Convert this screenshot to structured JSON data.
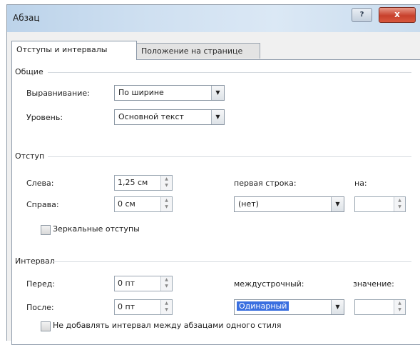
{
  "window": {
    "title": "Абзац",
    "help_label": "?",
    "close_label": "x"
  },
  "tabs": [
    {
      "label": "Отступы и интервалы"
    },
    {
      "label": "Положение на странице"
    }
  ],
  "general": {
    "heading": "Общие",
    "alignment_label": "Выравнивание:",
    "alignment_value": "По ширине",
    "level_label": "Уровень:",
    "level_value": "Основной текст"
  },
  "indent": {
    "heading": "Отступ",
    "left_label": "Слева:",
    "left_value": "1,25 см",
    "right_label": "Справа:",
    "right_value": "0 см",
    "first_line_label": "первая строка:",
    "first_line_value": "(нет)",
    "by_label": "на:",
    "by_value": "",
    "mirror_label": "Зеркальные отступы"
  },
  "spacing": {
    "heading": "Интервал",
    "before_label": "Перед:",
    "before_value": "0 пт",
    "after_label": "После:",
    "after_value": "0 пт",
    "line_spacing_label": "междустрочный:",
    "line_spacing_value": "Одинарный",
    "value_label": "значение:",
    "value_value": "",
    "no_space_label": "Не добавлять интервал между абзацами одного стиля"
  },
  "icons": {
    "dropdown": "▼",
    "spin_up": "▲",
    "spin_down": "▼"
  }
}
